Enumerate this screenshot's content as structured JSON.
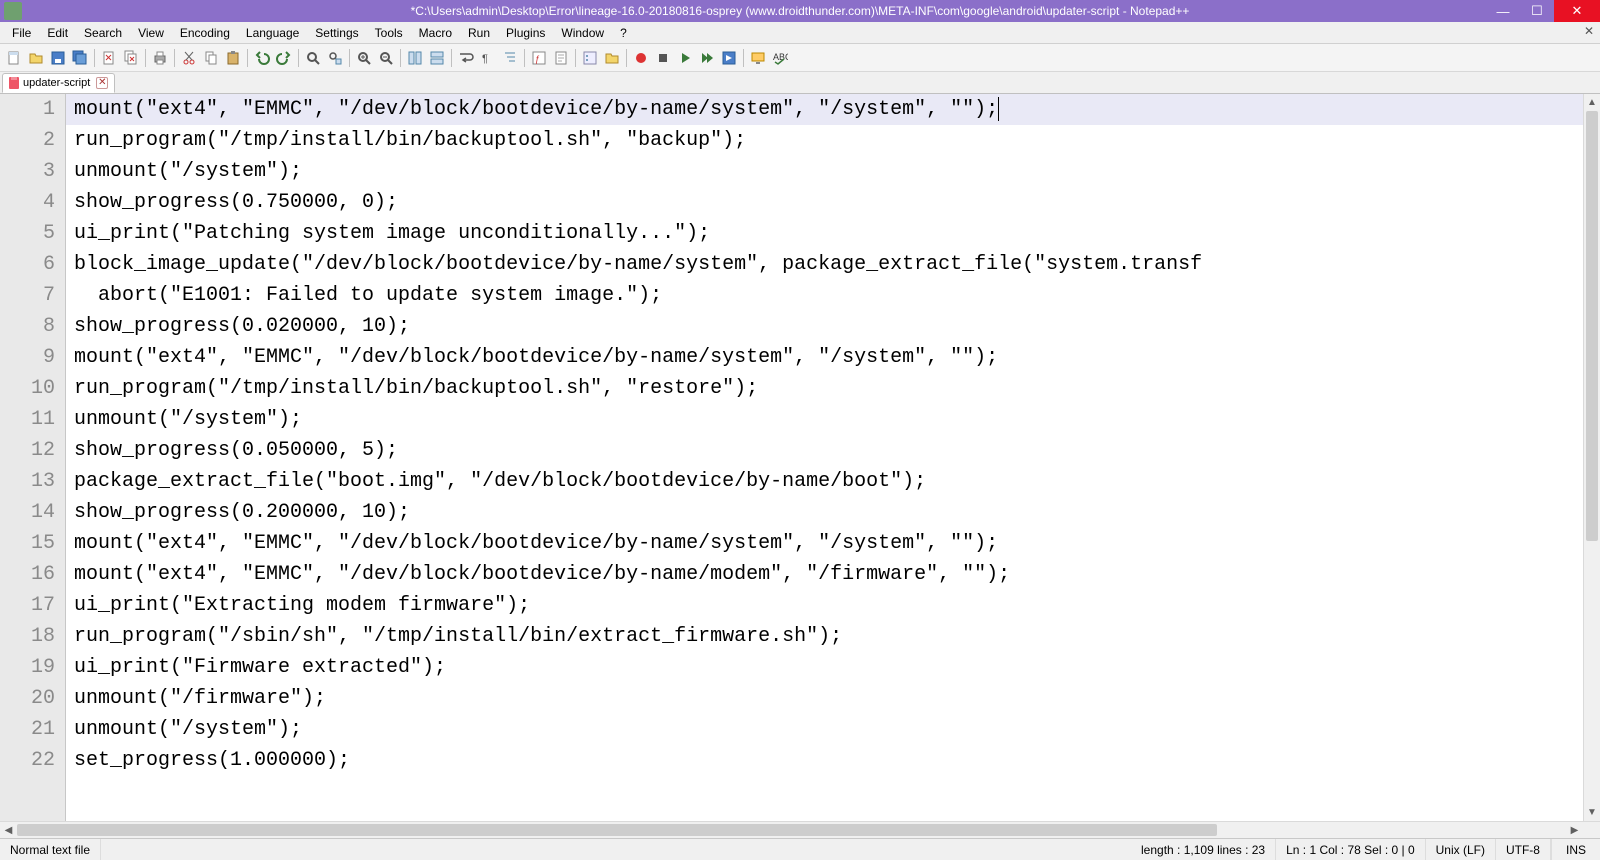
{
  "titlebar": {
    "text": "*C:\\Users\\admin\\Desktop\\Error\\lineage-16.0-20180816-osprey (www.droidthunder.com)\\META-INF\\com\\google\\android\\updater-script - Notepad++"
  },
  "menu": {
    "items": [
      "File",
      "Edit",
      "Search",
      "View",
      "Encoding",
      "Language",
      "Settings",
      "Tools",
      "Macro",
      "Run",
      "Plugins",
      "Window",
      "?"
    ]
  },
  "tab": {
    "name": "updater-script"
  },
  "code": {
    "lines": [
      "mount(\"ext4\", \"EMMC\", \"/dev/block/bootdevice/by-name/system\", \"/system\", \"\");",
      "run_program(\"/tmp/install/bin/backuptool.sh\", \"backup\");",
      "unmount(\"/system\");",
      "show_progress(0.750000, 0);",
      "ui_print(\"Patching system image unconditionally...\");",
      "block_image_update(\"/dev/block/bootdevice/by-name/system\", package_extract_file(\"system.transf",
      "  abort(\"E1001: Failed to update system image.\");",
      "show_progress(0.020000, 10);",
      "mount(\"ext4\", \"EMMC\", \"/dev/block/bootdevice/by-name/system\", \"/system\", \"\");",
      "run_program(\"/tmp/install/bin/backuptool.sh\", \"restore\");",
      "unmount(\"/system\");",
      "show_progress(0.050000, 5);",
      "package_extract_file(\"boot.img\", \"/dev/block/bootdevice/by-name/boot\");",
      "show_progress(0.200000, 10);",
      "mount(\"ext4\", \"EMMC\", \"/dev/block/bootdevice/by-name/system\", \"/system\", \"\");",
      "mount(\"ext4\", \"EMMC\", \"/dev/block/bootdevice/by-name/modem\", \"/firmware\", \"\");",
      "ui_print(\"Extracting modem firmware\");",
      "run_program(\"/sbin/sh\", \"/tmp/install/bin/extract_firmware.sh\");",
      "ui_print(\"Firmware extracted\");",
      "unmount(\"/firmware\");",
      "unmount(\"/system\");",
      "set_progress(1.000000);"
    ]
  },
  "status": {
    "filetype": "Normal text file",
    "length_label": "length : 1,109    lines : 23",
    "pos_label": "Ln : 1    Col : 78    Sel : 0 | 0",
    "eol": "Unix (LF)",
    "encoding": "UTF-8",
    "mode": "INS"
  },
  "toolbar_icons": [
    "new-file-icon",
    "open-file-icon",
    "save-icon",
    "save-all-icon",
    "sep",
    "close-icon",
    "close-all-icon",
    "sep",
    "print-icon",
    "sep",
    "cut-icon",
    "copy-icon",
    "paste-icon",
    "sep",
    "undo-icon",
    "redo-icon",
    "sep",
    "find-icon",
    "replace-icon",
    "sep",
    "zoom-in-icon",
    "zoom-out-icon",
    "sep",
    "sync-v-icon",
    "sync-h-icon",
    "sep",
    "wordwrap-icon",
    "all-chars-icon",
    "indent-guide-icon",
    "sep",
    "lang-icon",
    "doc-map-icon",
    "sep",
    "function-list-icon",
    "folder-icon",
    "sep",
    "record-icon",
    "stop-icon",
    "play-icon",
    "play-multi-icon",
    "save-macro-icon",
    "sep",
    "monitor-icon",
    "spellcheck-icon"
  ]
}
